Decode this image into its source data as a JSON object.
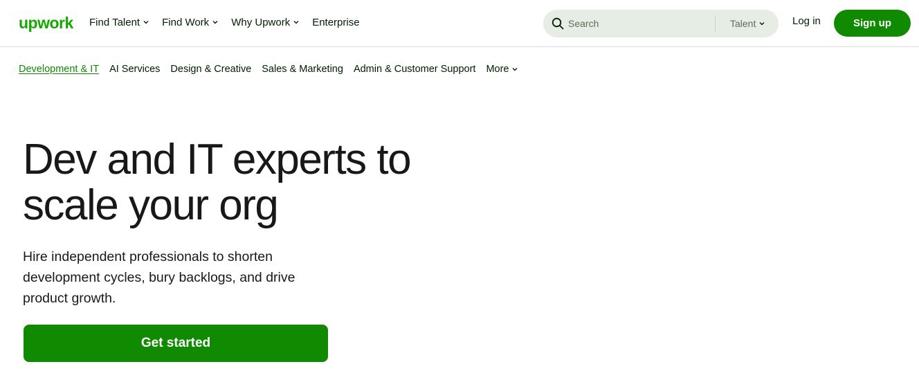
{
  "header": {
    "logo_text": "upwork",
    "nav": [
      {
        "label": "Find Talent",
        "has_menu": true
      },
      {
        "label": "Find Work",
        "has_menu": true
      },
      {
        "label": "Why Upwork",
        "has_menu": true
      },
      {
        "label": "Enterprise",
        "has_menu": false
      }
    ],
    "search": {
      "placeholder": "Search",
      "scope": "Talent"
    },
    "login_label": "Log in",
    "signup_label": "Sign up"
  },
  "subnav": {
    "items": [
      {
        "label": "Development & IT",
        "active": true
      },
      {
        "label": "AI Services"
      },
      {
        "label": "Design & Creative"
      },
      {
        "label": "Sales & Marketing"
      },
      {
        "label": "Admin & Customer Support"
      },
      {
        "label": "More",
        "has_menu": true
      }
    ]
  },
  "hero": {
    "title_line1": "Dev and IT experts to",
    "title_line2": "scale your org",
    "subtitle": "Hire independent professionals to shorten development cycles, bury backlogs, and drive product growth.",
    "cta_label": "Get started"
  },
  "colors": {
    "brand_green": "#14a800",
    "button_green": "#108a00",
    "search_bg": "#e5ede4"
  }
}
